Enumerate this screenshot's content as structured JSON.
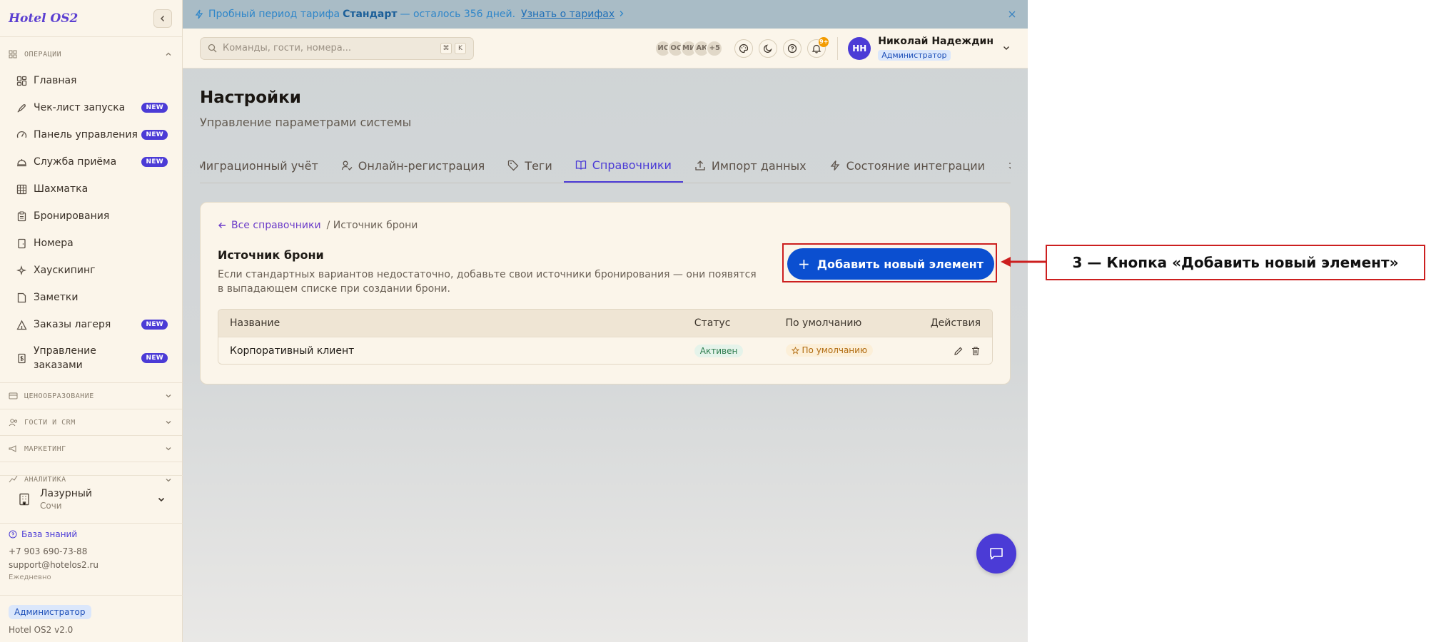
{
  "app": {
    "logo": "Hotel OS2"
  },
  "sidebar": {
    "sections": [
      {
        "label": "ОПЕРАЦИИ",
        "expanded": true
      },
      {
        "label": "ЦЕНООБРАЗОВАНИЕ",
        "expanded": false
      },
      {
        "label": "ГОСТИ И CRM",
        "expanded": false
      },
      {
        "label": "МАРКЕТИНГ",
        "expanded": false
      },
      {
        "label": "АНАЛИТИКА",
        "expanded": false
      }
    ],
    "items": [
      {
        "label": "Главная",
        "icon": "grid-icon",
        "badge": ""
      },
      {
        "label": "Чек-лист запуска",
        "icon": "rocket-icon",
        "badge": "NEW"
      },
      {
        "label": "Панель управления",
        "icon": "gauge-icon",
        "badge": "NEW"
      },
      {
        "label": "Служба приёма",
        "icon": "bell-service-icon",
        "badge": "NEW"
      },
      {
        "label": "Шахматка",
        "icon": "table-icon",
        "badge": ""
      },
      {
        "label": "Бронирования",
        "icon": "clipboard-icon",
        "badge": ""
      },
      {
        "label": "Номера",
        "icon": "door-icon",
        "badge": ""
      },
      {
        "label": "Хаускипинг",
        "icon": "sparkles-icon",
        "badge": ""
      },
      {
        "label": "Заметки",
        "icon": "note-icon",
        "badge": ""
      },
      {
        "label": "Заказы лагеря",
        "icon": "tent-icon",
        "badge": "NEW"
      },
      {
        "label": "Управление заказами",
        "icon": "receipt-icon",
        "badge": "NEW"
      }
    ],
    "hotel": {
      "name": "Лазурный",
      "city": "Сочи"
    },
    "support": {
      "kb_label": "База знаний",
      "phone": "+7 903 690-73-88",
      "email": "support@hotelos2.ru",
      "hours": "Ежедневно"
    },
    "role": "Администратор",
    "version": "Hotel OS2 v2.0"
  },
  "banner": {
    "prefix": "Пробный период тарифа",
    "plan": "Стандарт",
    "suffix": "— осталось 356 дней.",
    "link": "Узнать о тарифах"
  },
  "topbar": {
    "search_placeholder": "Команды, гости, номера...",
    "shortcut_keys": [
      "⌘",
      "K"
    ],
    "presence": [
      "ИС",
      "ОС",
      "МИ",
      "АК",
      "+5"
    ],
    "notif_count": "9+",
    "user": {
      "initials": "НН",
      "name": "Николай Надеждин",
      "role": "Администратор"
    }
  },
  "page": {
    "title": "Настройки",
    "subtitle": "Управление параметрами системы",
    "tabs": [
      {
        "label": "Миграционный учёт",
        "icon": "",
        "active": false
      },
      {
        "label": "Онлайн-регистрация",
        "icon": "user-check-icon",
        "active": false
      },
      {
        "label": "Теги",
        "icon": "tag-icon",
        "active": false
      },
      {
        "label": "Справочники",
        "icon": "book-icon",
        "active": true
      },
      {
        "label": "Импорт данных",
        "icon": "upload-icon",
        "active": false
      },
      {
        "label": "Состояние интеграции",
        "icon": "bolt-icon",
        "active": false
      },
      {
        "label": "Со",
        "icon": "swap-icon",
        "active": false
      }
    ]
  },
  "card": {
    "back_label": "Все справочники",
    "crumb_current": "/ Источник брони",
    "title": "Источник брони",
    "description": "Если стандартных вариантов недостаточно, добавьте свои источники бронирования — они появятся в выпадающем списке при создании брони.",
    "add_button": "Добавить новый элемент",
    "table": {
      "headers": [
        "Название",
        "Статус",
        "По умолчанию",
        "Действия"
      ],
      "rows": [
        {
          "name": "Корпоративный клиент",
          "status": "Активен",
          "default": "По умолчанию"
        }
      ]
    }
  },
  "annotation": {
    "label": "3 — Кнопка «Добавить новый элемент»",
    "color": "#cc1f1f"
  },
  "colors": {
    "accent": "#4b3bd6",
    "primary_button": "#0b4fd0",
    "sidebar_bg": "#fbf5ea"
  }
}
